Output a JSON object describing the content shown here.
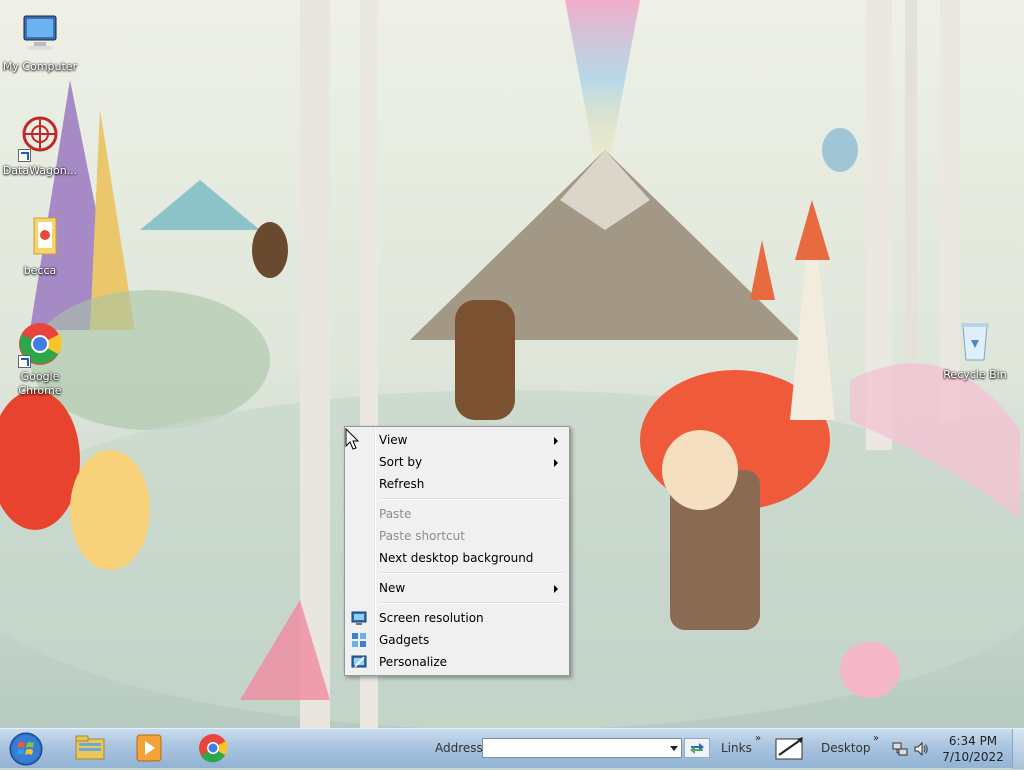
{
  "desktop": {
    "icons": [
      {
        "label": "My Computer",
        "icon": "computer-icon"
      },
      {
        "label": "DataWagon...",
        "icon": "datawagon-icon"
      },
      {
        "label": "becca",
        "icon": "folder-icon"
      },
      {
        "label": "Google Chrome",
        "icon": "chrome-icon"
      },
      {
        "label": "Recycle Bin",
        "icon": "recycle-bin-icon"
      }
    ]
  },
  "context_menu": {
    "items": [
      {
        "label": "View",
        "submenu": true,
        "enabled": true
      },
      {
        "label": "Sort by",
        "submenu": true,
        "enabled": true
      },
      {
        "label": "Refresh",
        "submenu": false,
        "enabled": true
      },
      {
        "label": "Paste",
        "submenu": false,
        "enabled": false
      },
      {
        "label": "Paste shortcut",
        "submenu": false,
        "enabled": false
      },
      {
        "label": "Next desktop background",
        "submenu": false,
        "enabled": true
      },
      {
        "label": "New",
        "submenu": true,
        "enabled": true
      },
      {
        "label": "Screen resolution",
        "icon": "screen-resolution-icon",
        "enabled": true
      },
      {
        "label": "Gadgets",
        "icon": "gadgets-icon",
        "enabled": true
      },
      {
        "label": "Personalize",
        "icon": "personalize-icon",
        "enabled": true
      }
    ]
  },
  "taskbar": {
    "pinned": [
      "windows-explorer-icon",
      "media-player-icon",
      "chrome-icon"
    ],
    "address_label": "Address",
    "address_value": "",
    "links_label": "Links",
    "chevron": "»",
    "desktop_label": "Desktop",
    "clock": {
      "time": "6:34 PM",
      "date": "7/10/2022"
    }
  },
  "colors": {
    "taskbar": "#a9c4df",
    "menu_bg": "#f0f0f0",
    "disabled_text": "#8d8d8d"
  }
}
